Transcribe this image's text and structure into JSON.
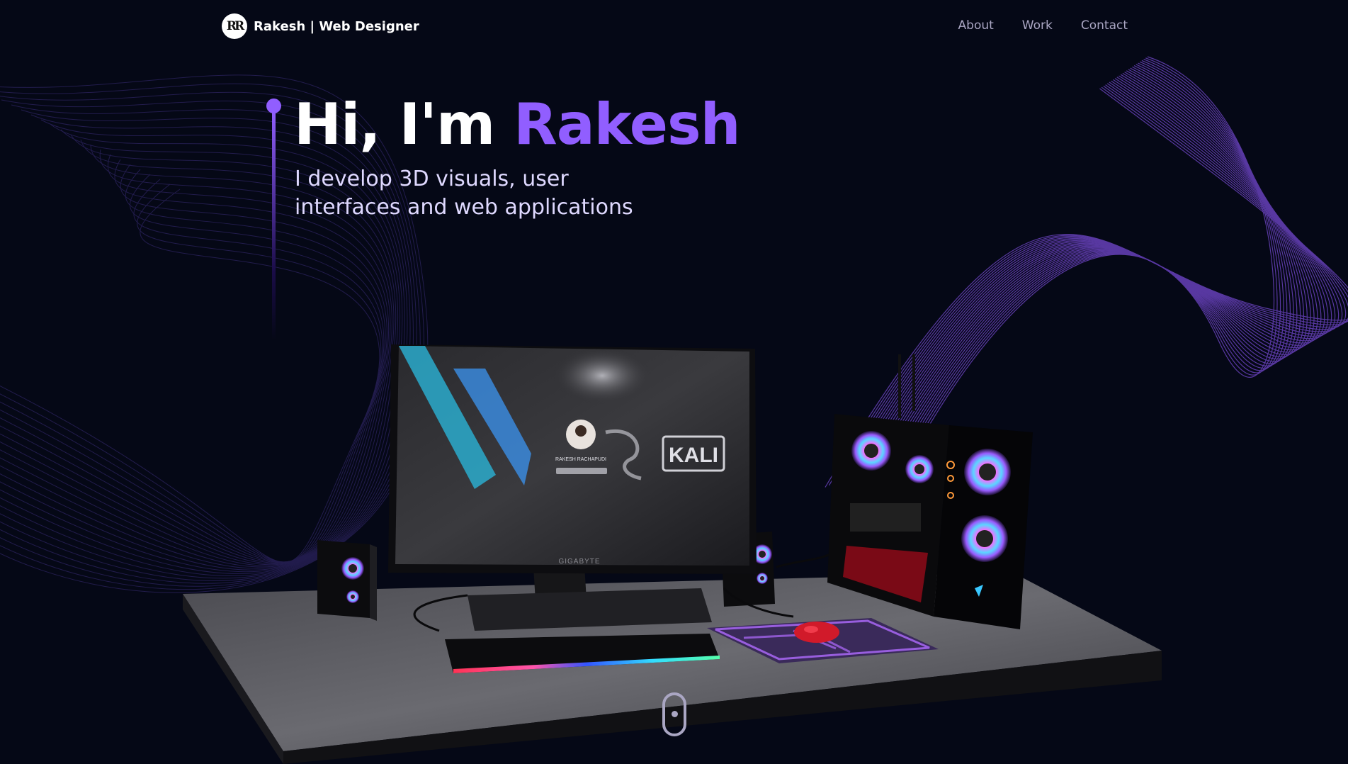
{
  "nav": {
    "logo_mark": "RR",
    "brand": "Rakesh | Web Designer",
    "links": [
      "About",
      "Work",
      "Contact"
    ]
  },
  "hero": {
    "greeting": "Hi, I'm",
    "name": "Rakesh",
    "subtitle": "I develop 3D visuals, user interfaces and web applications"
  },
  "monitor": {
    "brand": "GIGABYTE",
    "screen_user": "RAKESH RACHAPUDI",
    "screen_os": "KALI"
  },
  "colors": {
    "background": "#050816",
    "accent": "#915eff",
    "secondary_text": "#aaa6c3"
  },
  "icons": [
    "logo-icon",
    "scroll-down-icon"
  ]
}
